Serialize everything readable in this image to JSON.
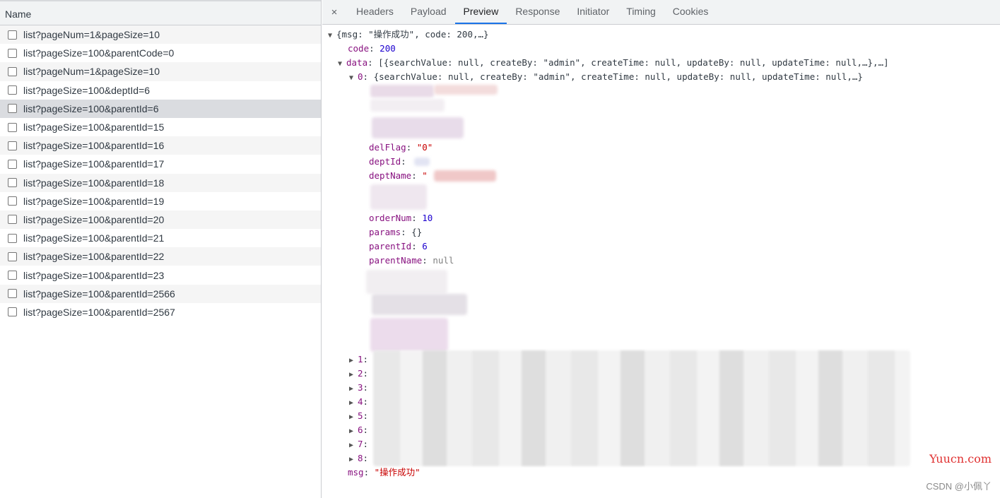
{
  "list": {
    "header": "Name",
    "items": [
      "list?pageNum=1&pageSize=10",
      "list?pageSize=100&parentCode=0",
      "list?pageNum=1&pageSize=10",
      "list?pageSize=100&deptId=6",
      "list?pageSize=100&parentId=6",
      "list?pageSize=100&parentId=15",
      "list?pageSize=100&parentId=16",
      "list?pageSize=100&parentId=17",
      "list?pageSize=100&parentId=18",
      "list?pageSize=100&parentId=19",
      "list?pageSize=100&parentId=20",
      "list?pageSize=100&parentId=21",
      "list?pageSize=100&parentId=22",
      "list?pageSize=100&parentId=23",
      "list?pageSize=100&parentId=2566",
      "list?pageSize=100&parentId=2567"
    ],
    "selected_index": 4
  },
  "tabs": {
    "close": "×",
    "items": [
      "Headers",
      "Payload",
      "Preview",
      "Response",
      "Initiator",
      "Timing",
      "Cookies"
    ],
    "active": "Preview"
  },
  "preview": {
    "root_summary": "{msg: \"操作成功\", code: 200,…}",
    "code_key": "code",
    "code_val": "200",
    "data_key": "data",
    "data_summary": "[{searchValue: null, createBy: \"admin\", createTime: null, updateBy: null, updateTime: null,…},…]",
    "item0_key": "0",
    "item0_summary": "{searchValue: null, createBy: \"admin\", createTime: null, updateBy: null, updateTime: null,…}",
    "fields": {
      "delFlag_key": "delFlag",
      "delFlag_val": "\"0\"",
      "deptId_key": "deptId",
      "deptName_key": "deptName",
      "deptName_val": "\"",
      "orderNum_key": "orderNum",
      "orderNum_val": "10",
      "params_key": "params",
      "params_val": "{}",
      "parentId_key": "parentId",
      "parentId_val": "6",
      "parentName_key": "parentName",
      "parentName_val": "null"
    },
    "collapsed_items": [
      "1",
      "2",
      "3",
      "4",
      "5",
      "6",
      "7",
      "8"
    ],
    "msg_key": "msg",
    "msg_val": "\"操作成功\""
  },
  "watermark": {
    "site": "Yuucn.com",
    "author": "CSDN @小佩丫"
  }
}
